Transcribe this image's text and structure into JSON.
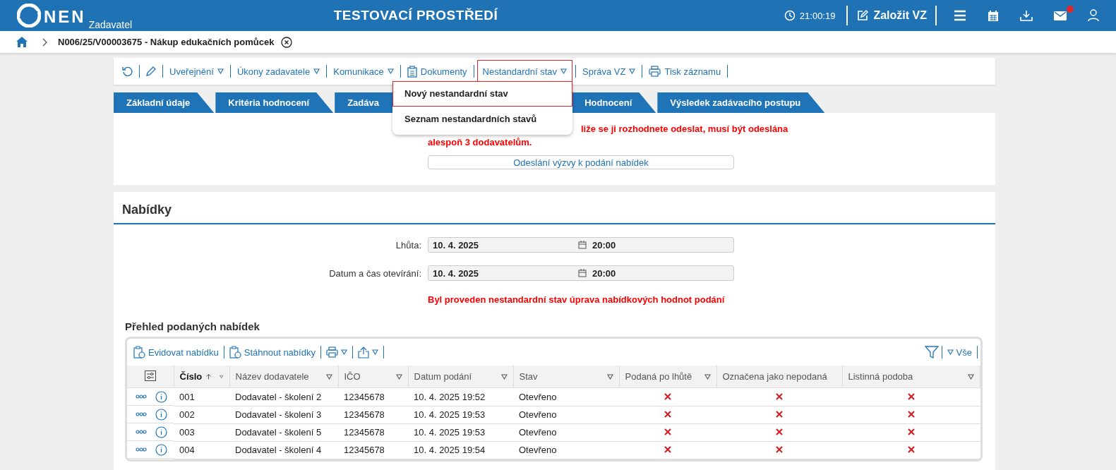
{
  "header": {
    "logo": "NEN",
    "logo_sub": "Zadavatel",
    "env_title": "TESTOVACÍ PROSTŘEDÍ",
    "time": "21:00:19",
    "create_button": "Založit VZ",
    "mail_unread": true
  },
  "breadcrumb": {
    "title": "N006/25/V00003675 - Nákup edukačních pomůcek"
  },
  "toolbar": [
    {
      "kind": "refresh"
    },
    {
      "kind": "edit"
    },
    {
      "kind": "menu",
      "label": "Uveřejnění",
      "open": false
    },
    {
      "kind": "menu",
      "label": "Úkony zadavatele",
      "open": false
    },
    {
      "kind": "menu",
      "label": "Komunikace",
      "open": false
    },
    {
      "kind": "documents",
      "label": "Dokumenty"
    },
    {
      "kind": "menu",
      "label": "Nestandardní stav",
      "open": true,
      "items": [
        {
          "label": "Nový nestandardní stav",
          "selected": true
        },
        {
          "label": "Seznam nestandardních stavů",
          "selected": false
        }
      ]
    },
    {
      "kind": "menu",
      "label": "Správa VZ",
      "open": false
    },
    {
      "kind": "print",
      "label": "Tisk záznamu"
    }
  ],
  "tabs": [
    {
      "label": "Základní údaje"
    },
    {
      "label": "Kritéria hodnocení"
    },
    {
      "label": "Zadáva"
    },
    {
      "label": "Hodnocení"
    },
    {
      "label": "Výsledek zadávacího postupu"
    }
  ],
  "notice": [
    "liže se ji rozhodnete odeslat, musí být odeslána",
    "alespoň 3 dodavatelům."
  ],
  "send_button": "Odeslání výzvy k podání nabídek",
  "offers": {
    "title": "Nabídky",
    "fields": [
      {
        "label": "Lhůta:",
        "date": "10. 4. 2025",
        "time": "20:00"
      },
      {
        "label": "Datum a čas otevírání:",
        "date": "10. 4. 2025",
        "time": "20:00"
      }
    ],
    "alert": "Byl proveden nestandardní stav úprava nabídkových hodnot podání",
    "subtitle": "Přehled podaných nabídek",
    "table_actions": [
      "Evidovat nabídku",
      "Stáhnout nabídky"
    ],
    "filter_label": "Vše",
    "columns": [
      {
        "label": "Číslo",
        "sorted": true
      },
      {
        "label": "Název dodavatele",
        "sorted": false
      },
      {
        "label": "IČO",
        "sorted": false
      },
      {
        "label": "Datum podání",
        "sorted": false
      },
      {
        "label": "Stav",
        "sorted": false
      },
      {
        "label": "Podaná po lhůtě",
        "sorted": false
      },
      {
        "label": "Označena jako nepodaná",
        "sorted": false
      },
      {
        "label": "Listinná podoba",
        "sorted": false
      }
    ],
    "rows": [
      {
        "number": "001",
        "supplier": "Dodavatel - školení 2",
        "ico": "12345678",
        "date": "10. 4. 2025 19:52",
        "status": "Otevřeno",
        "late": false,
        "not_submitted": false,
        "paper": false
      },
      {
        "number": "002",
        "supplier": "Dodavatel - školení 3",
        "ico": "12345678",
        "date": "10. 4. 2025 19:53",
        "status": "Otevřeno",
        "late": false,
        "not_submitted": false,
        "paper": false
      },
      {
        "number": "003",
        "supplier": "Dodavatel - školení 5",
        "ico": "12345678",
        "date": "10. 4. 2025 19:53",
        "status": "Otevřeno",
        "late": false,
        "not_submitted": false,
        "paper": false
      },
      {
        "number": "004",
        "supplier": "Dodavatel - školení 4",
        "ico": "12345678",
        "date": "10. 4. 2025 19:54",
        "status": "Otevřeno",
        "late": false,
        "not_submitted": false,
        "paper": false
      }
    ]
  }
}
